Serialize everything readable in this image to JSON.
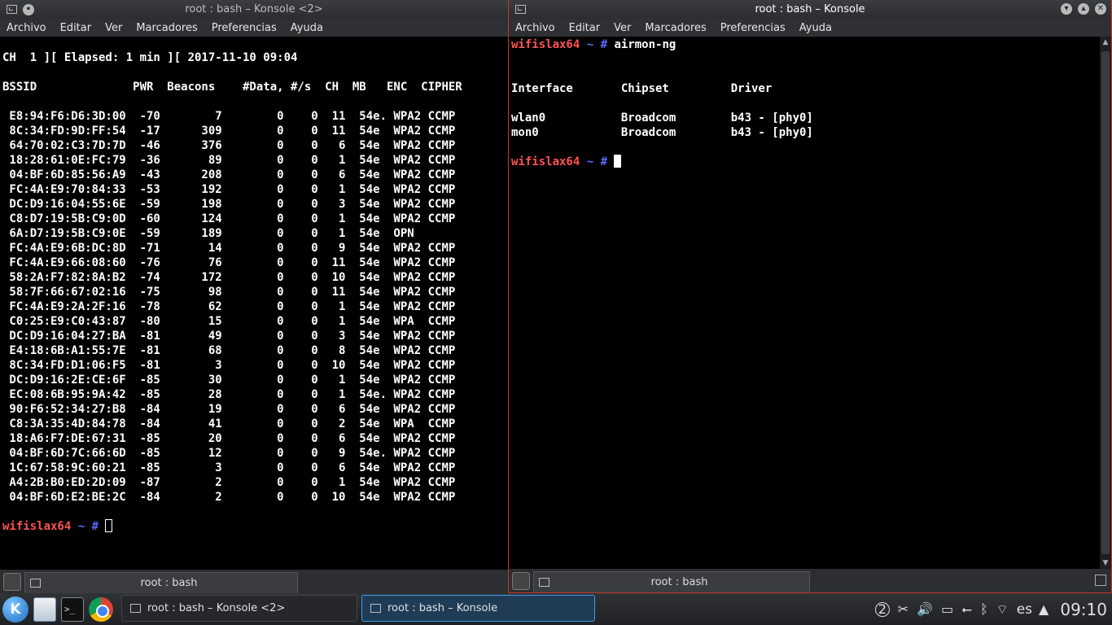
{
  "menu_items": [
    "Archivo",
    "Editar",
    "Ver",
    "Marcadores",
    "Preferencias",
    "Ayuda"
  ],
  "left_window": {
    "title": "root : bash – Konsole <2>",
    "tab_label": "root : bash",
    "status_line": "CH  1 ][ Elapsed: 1 min ][ 2017-11-10 09:04",
    "header": "BSSID              PWR  Beacons    #Data, #/s  CH  MB   ENC  CIPHER  ",
    "rows": [
      " E8:94:F6:D6:3D:00  -70        7        0    0  11  54e. WPA2 CCMP   ",
      " 8C:34:FD:9D:FF:54  -17      309        0    0  11  54e  WPA2 CCMP   ",
      " 64:70:02:C3:7D:7D  -46      376        0    0   6  54e  WPA2 CCMP   ",
      " 18:28:61:0E:FC:79  -36       89        0    0   1  54e  WPA2 CCMP   ",
      " 04:BF:6D:85:56:A9  -43      208        0    0   6  54e  WPA2 CCMP   ",
      " FC:4A:E9:70:84:33  -53      192        0    0   1  54e  WPA2 CCMP   ",
      " DC:D9:16:04:55:6E  -59      198        0    0   3  54e  WPA2 CCMP   ",
      " C8:D7:19:5B:C9:0D  -60      124        0    0   1  54e  WPA2 CCMP   ",
      " 6A:D7:19:5B:C9:0E  -59      189        0    0   1  54e  OPN         ",
      " FC:4A:E9:6B:DC:8D  -71       14        0    0   9  54e  WPA2 CCMP   ",
      " FC:4A:E9:66:08:60  -76       76        0    0  11  54e  WPA2 CCMP   ",
      " 58:2A:F7:82:8A:B2  -74      172        0    0  10  54e  WPA2 CCMP   ",
      " 58:7F:66:67:02:16  -75       98        0    0  11  54e  WPA2 CCMP   ",
      " FC:4A:E9:2A:2F:16  -78       62        0    0   1  54e  WPA2 CCMP   ",
      " C0:25:E9:C0:43:87  -80       15        0    0   1  54e  WPA  CCMP   ",
      " DC:D9:16:04:27:BA  -81       49        0    0   3  54e  WPA2 CCMP   ",
      " E4:18:6B:A1:55:7E  -81       68        0    0   8  54e  WPA2 CCMP   ",
      " 8C:34:FD:D1:06:F5  -81        3        0    0  10  54e  WPA2 CCMP   ",
      " DC:D9:16:2E:CE:6F  -85       30        0    0   1  54e  WPA2 CCMP   ",
      " EC:08:6B:95:9A:42  -85       28        0    0   1  54e. WPA2 CCMP   ",
      " 90:F6:52:34:27:B8  -84       19        0    0   6  54e  WPA2 CCMP   ",
      " C8:3A:35:4D:84:78  -84       41        0    0   2  54e  WPA  CCMP   ",
      " 18:A6:F7:DE:67:31  -85       20        0    0   6  54e  WPA2 CCMP   ",
      " 04:BF:6D:7C:66:6D  -85       12        0    0   9  54e. WPA2 CCMP   ",
      " 1C:67:58:9C:60:21  -85        3        0    0   6  54e  WPA2 CCMP   ",
      " A4:2B:B0:ED:2D:09  -87        2        0    0   1  54e  WPA2 CCMP   ",
      " 04:BF:6D:E2:BE:2C  -84        2        0    0  10  54e  WPA2 CCMP   "
    ],
    "prompt_host": "wifislax64",
    "prompt_symbol": " ~ # "
  },
  "right_window": {
    "title": "root : bash – Konsole",
    "tab_label": "root : bash",
    "prompt_host": "wifislax64",
    "prompt_symbol": " ~ # ",
    "command": "airmon-ng",
    "table_header": "Interface       Chipset         Driver",
    "table_rows": [
      "wlan0           Broadcom        b43 - [phy0]",
      "mon0            Broadcom        b43 - [phy0]"
    ]
  },
  "taskbar": {
    "kicker_label": "K",
    "tasks": [
      "root : bash – Konsole <2>",
      "root : bash – Konsole"
    ],
    "tray_badge": "2",
    "language": "es",
    "clock": "09:10"
  },
  "colors": {
    "prompt_host": "#ff5252",
    "prompt_separator": "#5b6cff",
    "active_window_border": "#c0392b",
    "active_task": "#3d9be9"
  }
}
